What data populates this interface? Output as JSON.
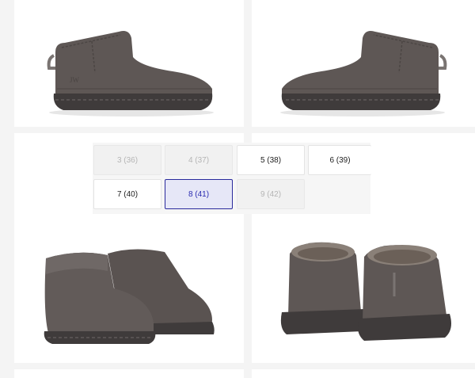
{
  "gallery": {
    "images": [
      {
        "alt": "boot-side-left",
        "color": "#5b5452"
      },
      {
        "alt": "boot-side-right",
        "color": "#5b5452"
      },
      {
        "alt": "boots-pair-front",
        "color": "#5b5452"
      },
      {
        "alt": "boots-pair-back",
        "color": "#5b5452"
      }
    ],
    "logo_text": "JW"
  },
  "size_selector": {
    "options": [
      {
        "label": "3 (36)",
        "state": "disabled"
      },
      {
        "label": "4 (37)",
        "state": "disabled"
      },
      {
        "label": "5 (38)",
        "state": "available"
      },
      {
        "label": "6 (39)",
        "state": "available"
      },
      {
        "label": "7 (40)",
        "state": "available"
      },
      {
        "label": "8 (41)",
        "state": "selected"
      },
      {
        "label": "9 (42)",
        "state": "disabled"
      }
    ]
  },
  "colors": {
    "selected_border": "#2a2a9c",
    "selected_bg": "#e6e7f7",
    "disabled_text": "#b5b5b5",
    "suede": "#5b5452",
    "sole": "#3e3a3a"
  }
}
